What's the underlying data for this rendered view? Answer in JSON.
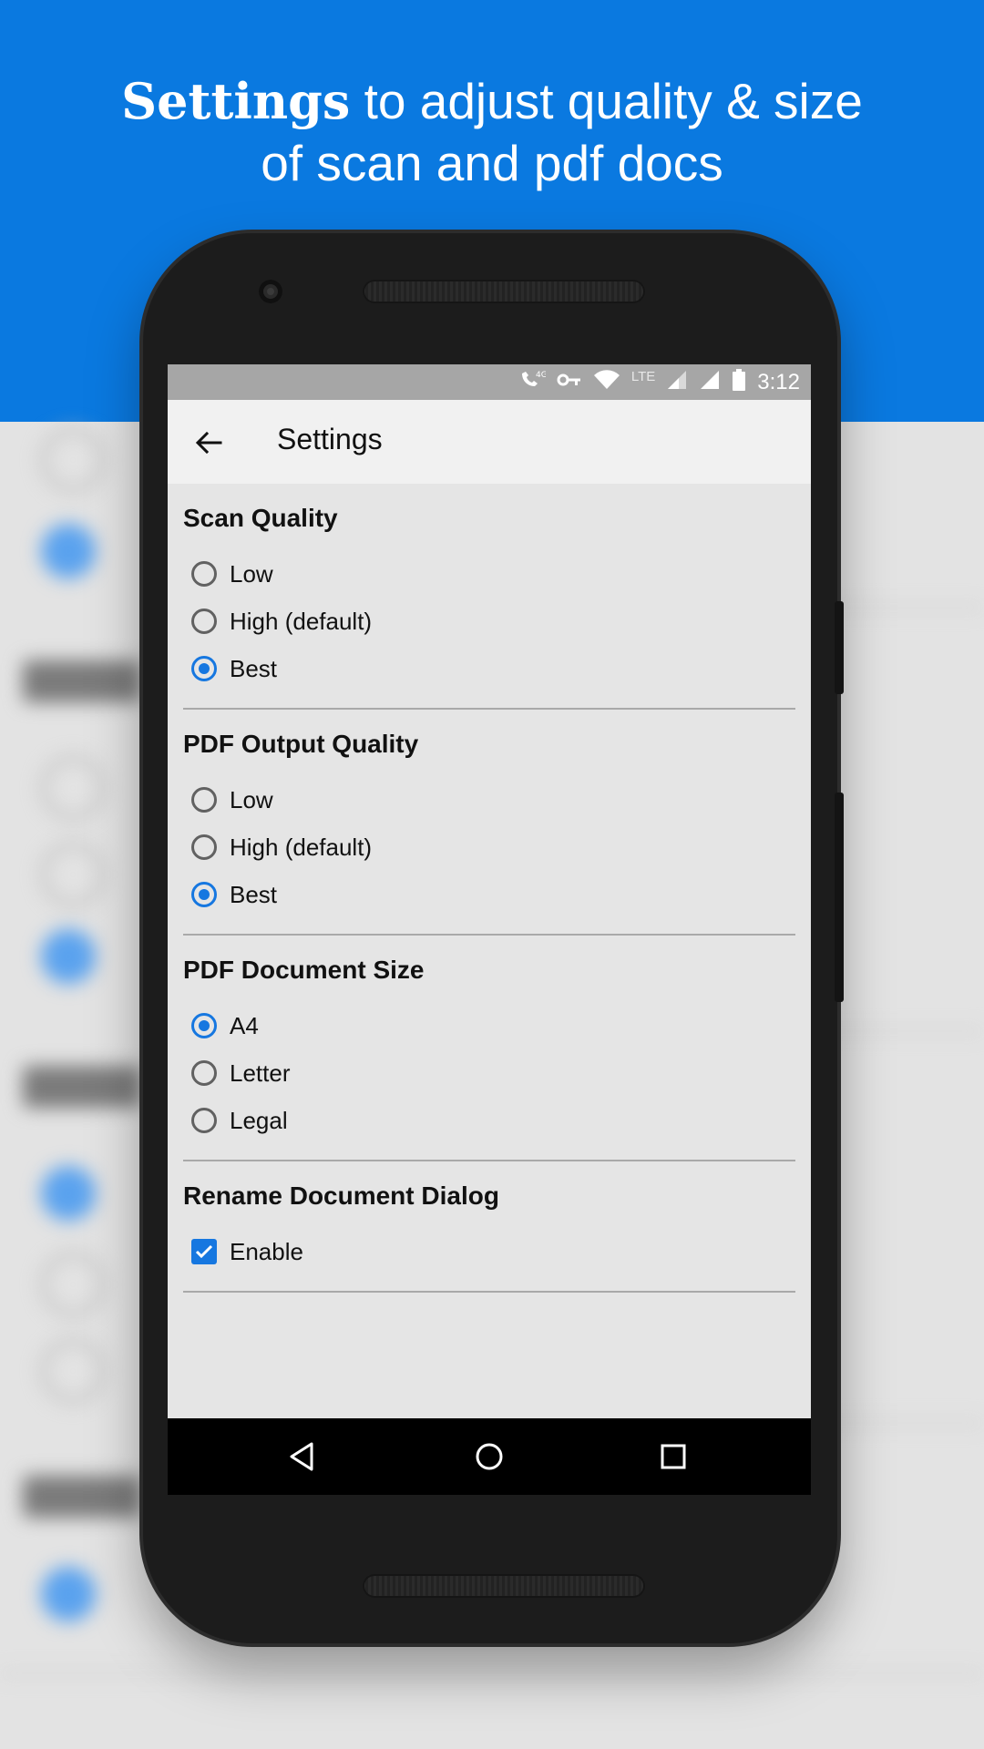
{
  "promo": {
    "headline_bold": "Settings",
    "headline_rest": " to adjust quality & size",
    "headline_line2": "of scan and pdf docs"
  },
  "colors": {
    "promo_blue": "#0a79e0",
    "accent": "#1677e0",
    "status_bar": "#a6a6a6",
    "app_bar": "#f1f1f1"
  },
  "status_bar": {
    "icons": [
      "call-4g-icon",
      "vpn-key-icon",
      "wifi-icon",
      "lte-icon",
      "signal-icon",
      "signal-icon",
      "battery-icon"
    ],
    "lte_label": "LTE",
    "time": "3:12"
  },
  "app_bar": {
    "back_icon": "arrow-left-icon",
    "title": "Settings"
  },
  "sections": [
    {
      "title": "Scan Quality",
      "options": [
        {
          "label": "Low",
          "selected": false
        },
        {
          "label": "High (default)",
          "selected": false
        },
        {
          "label": "Best",
          "selected": true
        }
      ]
    },
    {
      "title": "PDF Output Quality",
      "options": [
        {
          "label": "Low",
          "selected": false
        },
        {
          "label": "High (default)",
          "selected": false
        },
        {
          "label": "Best",
          "selected": true
        }
      ]
    },
    {
      "title": "PDF Document Size",
      "options": [
        {
          "label": "A4",
          "selected": true
        },
        {
          "label": "Letter",
          "selected": false
        },
        {
          "label": "Legal",
          "selected": false
        }
      ]
    },
    {
      "title": "Rename Document Dialog",
      "checkbox": {
        "label": "Enable",
        "checked": true
      }
    }
  ],
  "nav_bar": {
    "icons": [
      "back-triangle-icon",
      "home-circle-icon",
      "recents-square-icon"
    ]
  }
}
